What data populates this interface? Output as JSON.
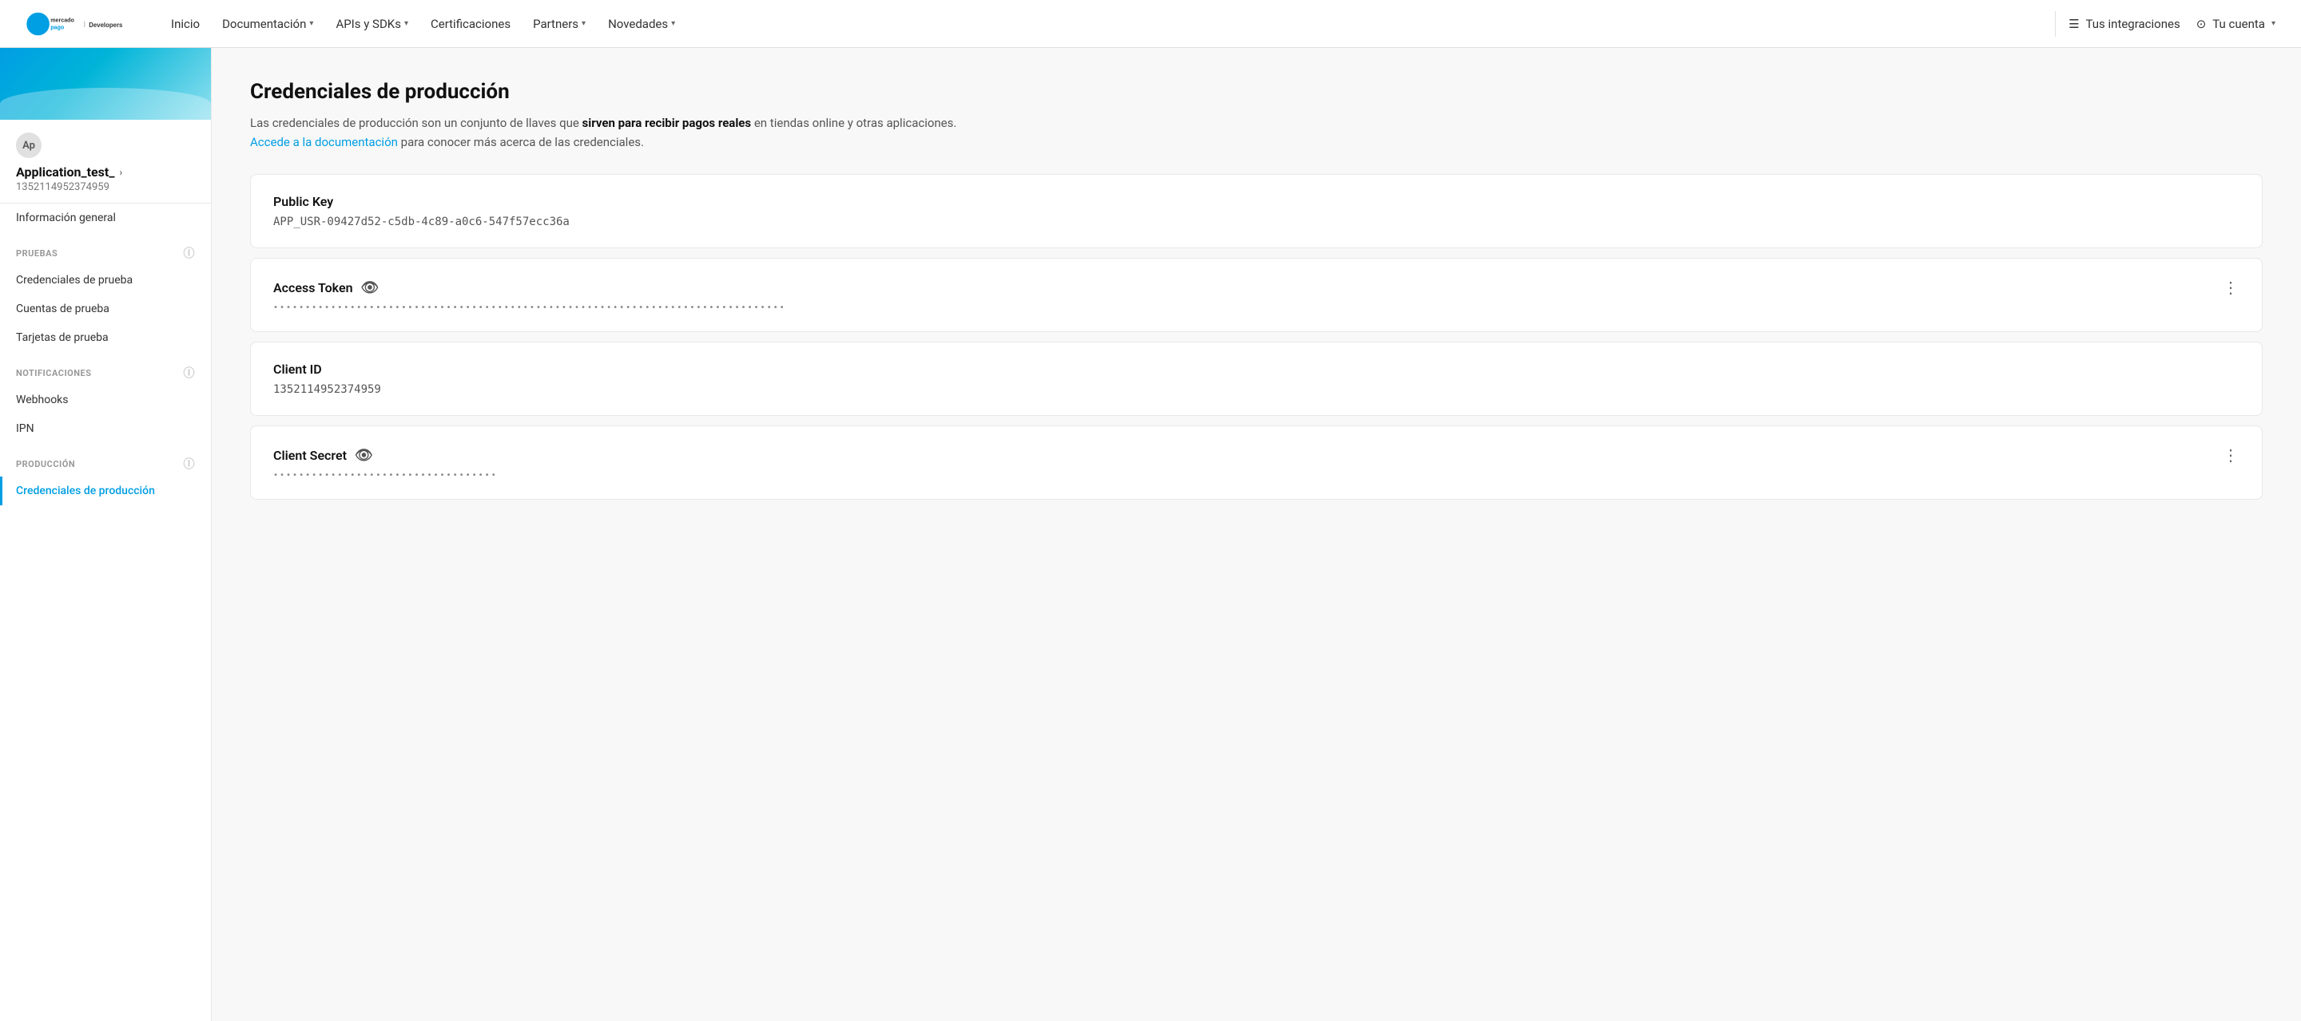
{
  "topnav": {
    "logo_alt": "Mercado Pago Developers",
    "links": [
      {
        "label": "Inicio",
        "has_dropdown": false
      },
      {
        "label": "Documentación",
        "has_dropdown": true
      },
      {
        "label": "APIs y SDKs",
        "has_dropdown": true
      },
      {
        "label": "Certificaciones",
        "has_dropdown": false
      },
      {
        "label": "Partners",
        "has_dropdown": true
      },
      {
        "label": "Novedades",
        "has_dropdown": true
      }
    ],
    "integrations_label": "Tus integraciones",
    "account_label": "Tu cuenta"
  },
  "sidebar": {
    "banner_alt": "Decorative banner",
    "avatar_initials": "Ap",
    "app_name": "Application_test_",
    "app_id": "1352114952374959",
    "nav_general": "Información general",
    "section_pruebas": "PRUEBAS",
    "nav_credenciales_prueba": "Credenciales de prueba",
    "nav_cuentas_prueba": "Cuentas de prueba",
    "nav_tarjetas_prueba": "Tarjetas de prueba",
    "section_notificaciones": "NOTIFICACIONES",
    "nav_webhooks": "Webhooks",
    "nav_ipn": "IPN",
    "section_produccion": "PRODUCCIÓN",
    "nav_credenciales_produccion": "Credenciales de producción"
  },
  "main": {
    "page_title": "Credenciales de producción",
    "page_desc_prefix": "Las credenciales de producción son un conjunto de llaves que ",
    "page_desc_bold": "sirven para recibir pagos reales",
    "page_desc_mid": " en tiendas online y otras aplicaciones. ",
    "page_desc_link": "Accede a la documentación",
    "page_desc_suffix": " para conocer más acerca de las credenciales.",
    "credentials": [
      {
        "label": "Public Key",
        "has_eye": false,
        "has_more": false,
        "value": "APP_USR-09427d52-c5db-4c89-a0c6-547f57ecc36a",
        "is_dots": false
      },
      {
        "label": "Access Token",
        "has_eye": true,
        "has_more": true,
        "value": "••••••••••••••••••••••••••••••••••••••••••••••••••••••••••••••••••••••••••••••••",
        "is_dots": true
      },
      {
        "label": "Client ID",
        "has_eye": false,
        "has_more": false,
        "value": "1352114952374959",
        "is_dots": false
      },
      {
        "label": "Client Secret",
        "has_eye": true,
        "has_more": true,
        "value": "•••••••••••••••••••••••••••••••••••",
        "is_dots": true
      }
    ]
  }
}
